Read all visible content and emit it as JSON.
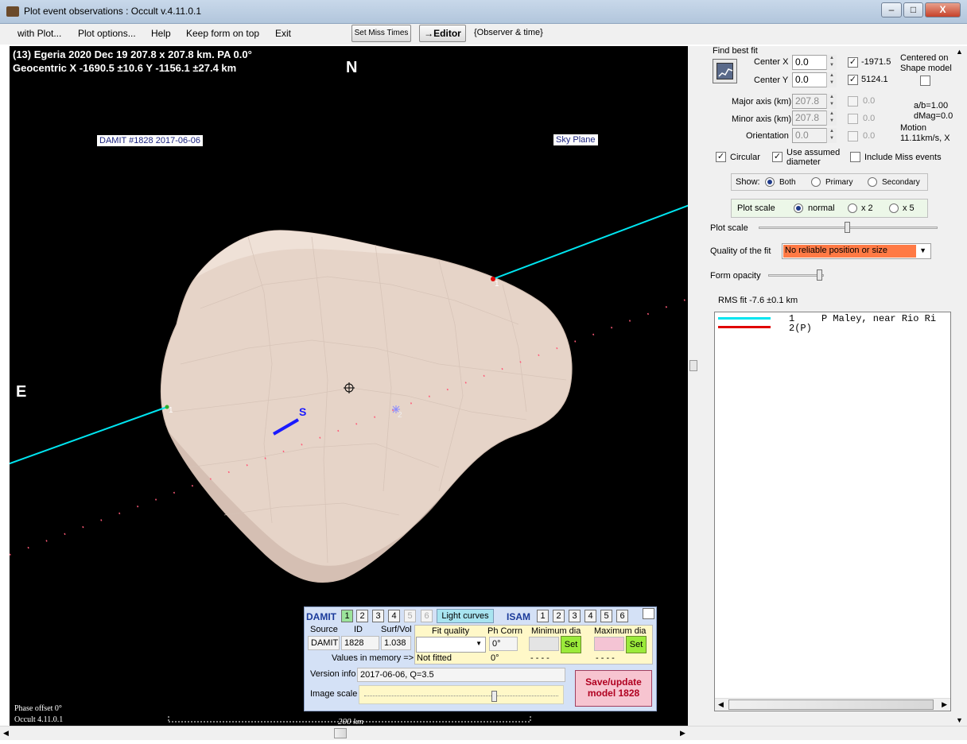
{
  "window": {
    "title": "Plot event observations : Occult v.4.11.0.1",
    "min_label": "–",
    "max_label": "□",
    "close_label": "X"
  },
  "menu": {
    "items": [
      "with Plot...",
      "Plot options...",
      "Help",
      "Keep form on top",
      "Exit"
    ],
    "set_miss_times": "Set Miss Times",
    "editor": "→Editor",
    "observer_time": "{Observer & time}"
  },
  "plot": {
    "header_line1": "(13) Egeria  2020 Dec 19  207.8 x 207.8 km.  PA 0.0°",
    "header_line2": "Geocentric  X  -1690.5 ±10.6  Y -1156.1 ±27.4 km",
    "north": "N",
    "east": "E",
    "damit_label": "DAMIT #1828 2017-06-06",
    "sky_plane": "Sky Plane",
    "south_marker": "S",
    "chord_number": "1",
    "miss_number": "2",
    "phase_offset": "Phase offset 0°",
    "version_footer": "Occult 4.11.0.1",
    "scale_bar": "200 km",
    "chord_color": "#00e5f0",
    "shape_color": "#e8d6cb",
    "pole_color": "#1a1aff"
  },
  "fit": {
    "heading": "Find best fit",
    "center_x_label": "Center X",
    "center_x_value": "0.0",
    "center_y_label": "Center Y",
    "center_y_value": "0.0",
    "center_x_result": "-1971.5",
    "center_y_result": "5124.1",
    "centered_on": "Centered on",
    "shape_model": "Shape model",
    "major_axis_label": "Major axis (km)",
    "major_axis_value": "207.8",
    "major_axis_result": "0.0",
    "minor_axis_label": "Minor axis (km)",
    "minor_axis_value": "207.8",
    "minor_axis_result": "0.0",
    "orientation_label": "Orientation",
    "orientation_value": "0.0",
    "orientation_result": "0.0",
    "ab_ratio": "a/b=1.00",
    "dmag": "dMag=0.00",
    "motion_label": "Motion",
    "motion_value": "11.11km/s, X",
    "circular": "Circular",
    "use_assumed_1": "Use assumed",
    "use_assumed_2": "diameter",
    "include_miss": "Include Miss events",
    "show_label": "Show:",
    "show_options": [
      "Both",
      "Primary",
      "Secondary"
    ],
    "plot_scale_group": "Plot scale",
    "scale_options": [
      "normal",
      "x 2",
      "x 5"
    ],
    "plot_scale_slider": "Plot scale",
    "quality_label": "Quality of the fit",
    "quality_value": "No reliable position or size",
    "form_opacity": "Form opacity",
    "rms": "RMS fit -7.6 ±0.1 km"
  },
  "results": {
    "rows": [
      {
        "num": "1",
        "text": "P Maley, near Rio Ri",
        "color": "#00e5f0"
      },
      {
        "num": "2(P)",
        "text": "",
        "color": "#e00000"
      }
    ]
  },
  "damit": {
    "title": "DAMIT",
    "damit_buttons": [
      "1",
      "2",
      "3",
      "4",
      "5",
      "6"
    ],
    "light_curves": "Light curves",
    "isam": "ISAM",
    "isam_buttons": [
      "1",
      "2",
      "3",
      "4",
      "5",
      "6"
    ],
    "source_label": "Source",
    "id_label": "ID",
    "surfvol_label": "Surf/Vol",
    "source_value": "DAMIT",
    "id_value": "1828",
    "surfvol_value": "1.038",
    "fit_quality": "Fit quality",
    "ph_corrn": "Ph Corrn",
    "min_dia": "Minimum dia",
    "max_dia": "Maximum dia",
    "ph_value": "0°",
    "set_label": "Set",
    "values_in_memory": "Values in memory =>",
    "not_fitted": "Not fitted",
    "ph_memory": "0°",
    "min_memory": "- - - -",
    "max_memory": "- - - -",
    "version_label": "Version info",
    "version_value": "2017-06-06, Q=3.5",
    "image_scale": "Image scale",
    "save_line1": "Save/update",
    "save_line2": "model 1828"
  }
}
